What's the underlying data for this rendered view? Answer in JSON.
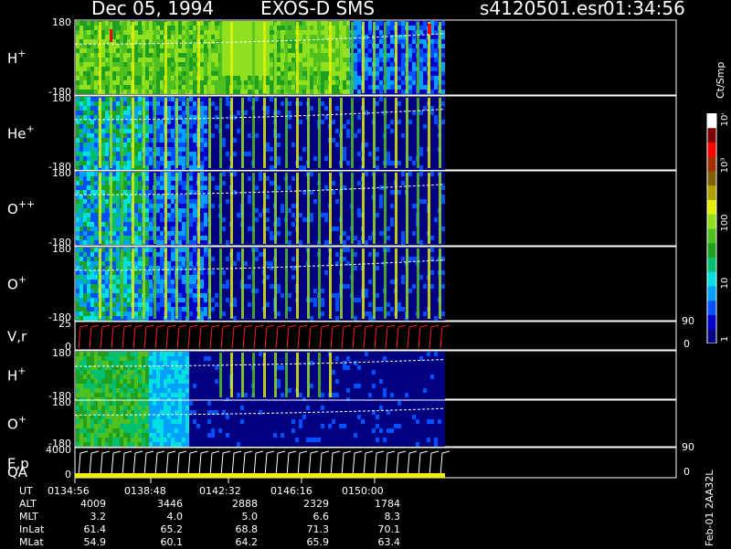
{
  "header": {
    "date": "Dec 05, 1994",
    "instrument": "EXOS-D SMS",
    "file": "s4120501.esr",
    "time": "01:34:56"
  },
  "chart_data": {
    "type": "heatmap",
    "panels": [
      {
        "id": "h-plus-1",
        "label": "H",
        "sup": "+",
        "ymax": "180",
        "ymin": "-180",
        "style": "spectrogram"
      },
      {
        "id": "he-plus",
        "label": "He",
        "sup": "+",
        "ymax": "180",
        "ymin": "-180",
        "style": "spectrogram"
      },
      {
        "id": "o-plus-plus",
        "label": "O",
        "sup": "++",
        "ymax": "180",
        "ymin": "-180",
        "style": "spectrogram"
      },
      {
        "id": "o-plus-1",
        "label": "O",
        "sup": "+",
        "ymax": "180",
        "ymin": "-180",
        "style": "spectrogram"
      },
      {
        "id": "v-r",
        "label": "V,r",
        "sup": "",
        "ymax": "25",
        "ymin": "0",
        "right_top": "90",
        "right_bottom": "0",
        "style": "line"
      },
      {
        "id": "h-plus-2",
        "label": "H",
        "sup": "+",
        "ymax": "180",
        "ymin": "-180",
        "style": "spectrogram"
      },
      {
        "id": "o-plus-2",
        "label": "O",
        "sup": "+",
        "ymax": "180",
        "ymin": "-180",
        "style": "spectrogram"
      },
      {
        "id": "e-p-qa",
        "label": "E,p",
        "label2": "QA",
        "sup": "",
        "ymax": "4000",
        "ymin": "0",
        "right_top": "90",
        "right_bottom": "0",
        "style": "line"
      }
    ],
    "colorbar": {
      "unit": "Ct/Smp",
      "ticks": [
        "1",
        "10",
        "100",
        "10³",
        "10⁴"
      ],
      "colors": [
        "#000080",
        "#0000c8",
        "#0050ff",
        "#00a0ff",
        "#00e0e0",
        "#00c070",
        "#20a020",
        "#50c020",
        "#90e020",
        "#e0f000",
        "#b0a000",
        "#806000",
        "#a03000",
        "#ff0000",
        "#800000",
        "#ffffff"
      ]
    }
  },
  "footer": {
    "rows": [
      {
        "label": "UT",
        "values": [
          "0134:56",
          "0138:48",
          "0142:32",
          "0146:16",
          "0150:00"
        ]
      },
      {
        "label": "ALT",
        "values": [
          "4009",
          "3446",
          "2888",
          "2329",
          "1784"
        ]
      },
      {
        "label": "MLT",
        "values": [
          "3.2",
          "4.0",
          "5.0",
          "6.6",
          "8.3"
        ]
      },
      {
        "label": "InLat",
        "values": [
          "61.4",
          "65.2",
          "68.8",
          "71.3",
          "70.1"
        ]
      },
      {
        "label": "MLat",
        "values": [
          "54.9",
          "60.1",
          "64.2",
          "65.9",
          "63.4"
        ]
      }
    ],
    "stamp": "Feb-01 2AA32L"
  }
}
